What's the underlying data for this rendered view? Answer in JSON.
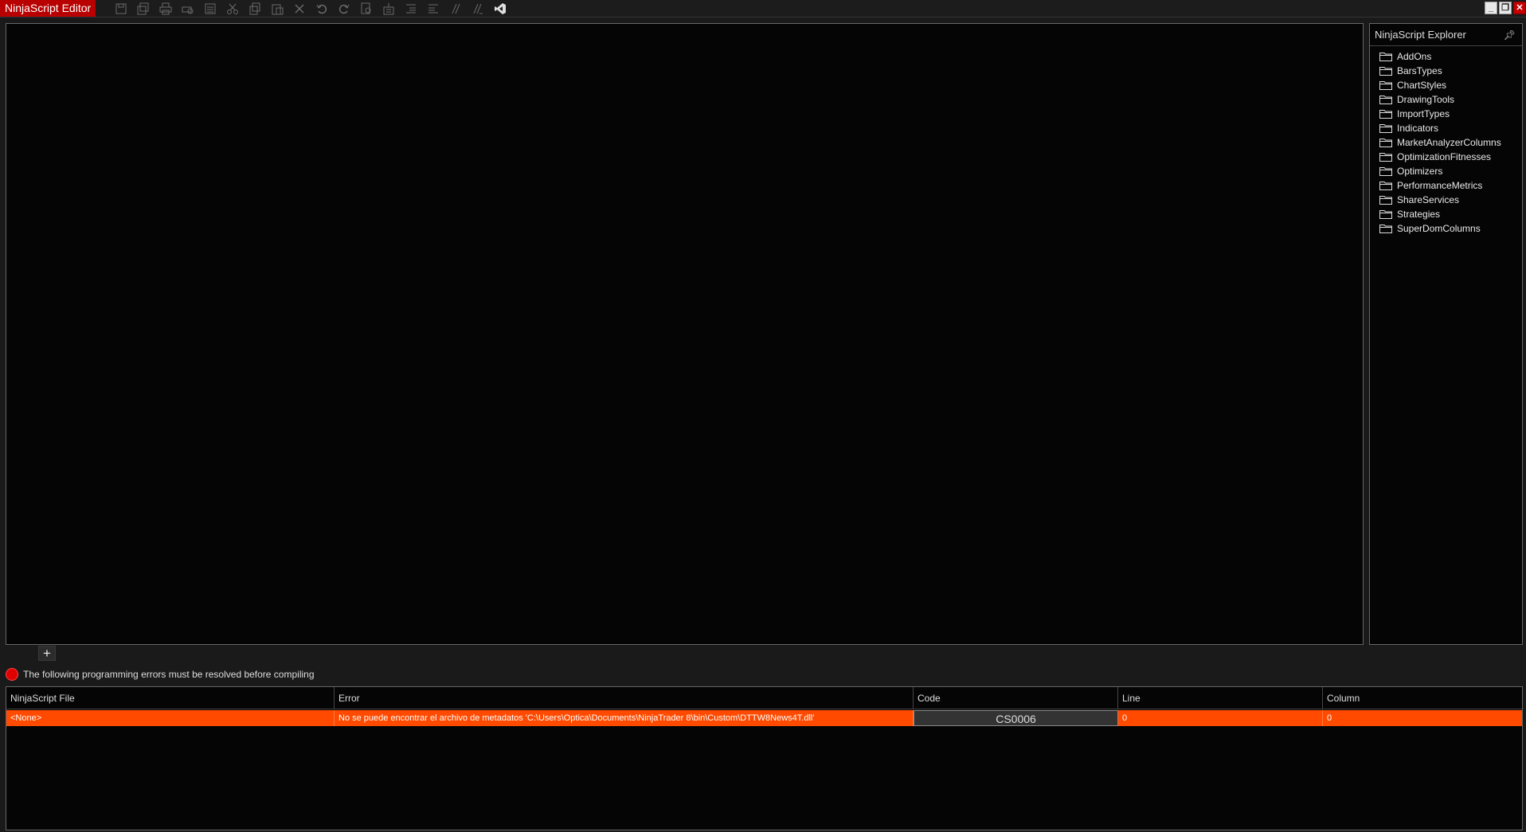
{
  "window": {
    "title": "NinjaScript Editor"
  },
  "toolbar": {
    "icons": [
      "save-icon",
      "save-all-icon",
      "print-icon",
      "print-preview-icon",
      "properties-icon",
      "cut-icon",
      "copy-icon",
      "paste-icon",
      "delete-icon",
      "undo-icon",
      "redo-icon",
      "find-icon",
      "compile-icon",
      "outdent-icon",
      "indent-icon",
      "comment-icon",
      "uncomment-icon",
      "visual-studio-icon"
    ]
  },
  "explorer": {
    "title": "NinjaScript Explorer",
    "items": [
      {
        "label": "AddOns"
      },
      {
        "label": "BarsTypes"
      },
      {
        "label": "ChartStyles"
      },
      {
        "label": "DrawingTools"
      },
      {
        "label": "ImportTypes"
      },
      {
        "label": "Indicators"
      },
      {
        "label": "MarketAnalyzerColumns"
      },
      {
        "label": "OptimizationFitnesses"
      },
      {
        "label": "Optimizers"
      },
      {
        "label": "PerformanceMetrics"
      },
      {
        "label": "ShareServices"
      },
      {
        "label": "Strategies"
      },
      {
        "label": "SuperDomColumns"
      }
    ]
  },
  "tabs": {
    "add_label": "+"
  },
  "errors": {
    "message": "The following programming errors must be resolved before compiling",
    "columns": [
      "NinjaScript File",
      "Error",
      "Code",
      "Line",
      "Column"
    ],
    "rows": [
      {
        "file": "<None>",
        "error": "No se puede encontrar el archivo de metadatos 'C:\\Users\\Optica\\Documents\\NinjaTrader 8\\bin\\Custom\\DTTW8News4T.dll'",
        "code": "CS0006",
        "line": "0",
        "column": "0"
      }
    ]
  },
  "colors": {
    "accent": "#b80000",
    "error_row": "#ff4a00",
    "error_dot": "#e00000"
  }
}
